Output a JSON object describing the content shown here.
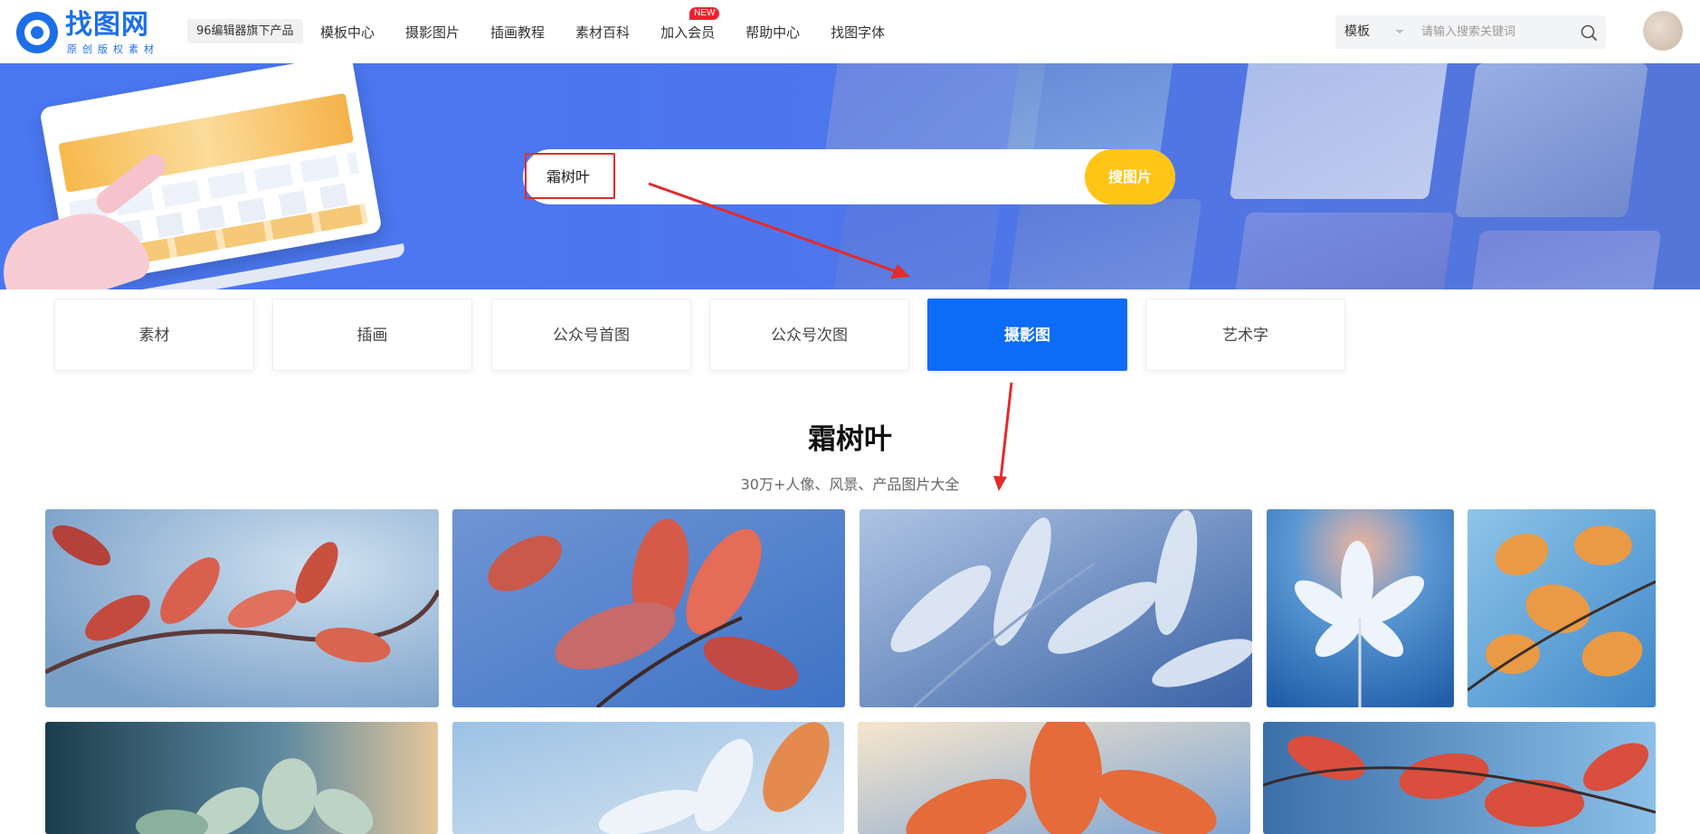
{
  "header": {
    "logo_text": "找图网",
    "logo_sub": "原创版权素材",
    "product_badge": "96编辑器旗下产品",
    "nav": [
      {
        "label": "模板中心"
      },
      {
        "label": "摄影图片"
      },
      {
        "label": "插画教程"
      },
      {
        "label": "素材百科"
      },
      {
        "label": "加入会员",
        "badge": "NEW"
      },
      {
        "label": "帮助中心"
      },
      {
        "label": "找图字体"
      }
    ],
    "search": {
      "category": "模板",
      "placeholder": "请输入搜索关键词",
      "icon": "search-icon"
    }
  },
  "hero": {
    "query": "霜树叶",
    "button": "搜图片"
  },
  "categories": [
    {
      "label": "素材",
      "active": false
    },
    {
      "label": "插画",
      "active": false
    },
    {
      "label": "公众号首图",
      "active": false
    },
    {
      "label": "公众号次图",
      "active": false
    },
    {
      "label": "摄影图",
      "active": true
    },
    {
      "label": "艺术字",
      "active": false
    }
  ],
  "result": {
    "title": "霜树叶",
    "subtitle": "30万+人像、风景、产品图片大全"
  },
  "colors": {
    "brand": "#1d6fe8",
    "active_tab": "#0c6cf6",
    "search_button": "#fec517",
    "annotation_red": "#e32b2b",
    "banner": "#4a78f2"
  },
  "thumbnails": [
    {
      "theme": "frosted red leaves on branch"
    },
    {
      "theme": "frosted red leaf with blue sky"
    },
    {
      "theme": "frosted silver leaves blue"
    },
    {
      "theme": "white frosted maple leaf"
    },
    {
      "theme": "orange frosted maple leaves"
    },
    {
      "theme": "frosted green leaves"
    },
    {
      "theme": "frosted white leaf with orange edges"
    },
    {
      "theme": "orange maple leaves backlit"
    },
    {
      "theme": "red maple leaves blue sky"
    }
  ]
}
